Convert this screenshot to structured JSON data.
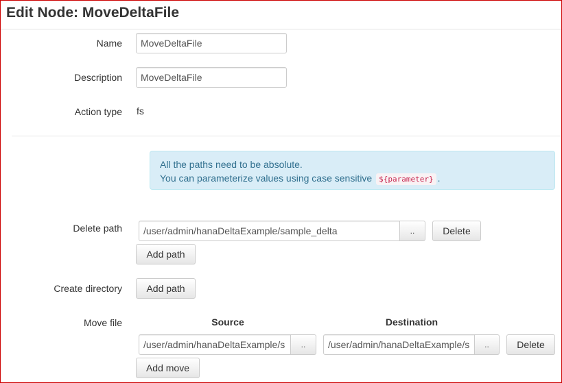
{
  "header": {
    "title": "Edit Node: MoveDeltaFile"
  },
  "form": {
    "name": {
      "label": "Name",
      "value": "MoveDeltaFile"
    },
    "description": {
      "label": "Description",
      "value": "MoveDeltaFile"
    },
    "action_type": {
      "label": "Action type",
      "value": "fs"
    }
  },
  "info": {
    "line1": "All the paths need to be absolute.",
    "line2_prefix": "You can parameterize values using case sensitive",
    "code": "${parameter}",
    "line2_suffix": "."
  },
  "delete_path": {
    "label": "Delete path",
    "value": "/user/admin/hanaDeltaExample/sample_delta",
    "browse_label": "..",
    "delete_label": "Delete",
    "add_label": "Add path"
  },
  "create_directory": {
    "label": "Create directory",
    "add_label": "Add path"
  },
  "move_file": {
    "label": "Move file",
    "source_header": "Source",
    "destination_header": "Destination",
    "source_value": "/user/admin/hanaDeltaExample/s",
    "destination_value": "/user/admin/hanaDeltaExample/s",
    "browse_label": "..",
    "delete_label": "Delete",
    "add_label": "Add move"
  },
  "colors": {
    "info_background": "#d9edf7",
    "info_text": "#31708f",
    "window_border": "#cc0000",
    "code_text": "#c7254e"
  }
}
